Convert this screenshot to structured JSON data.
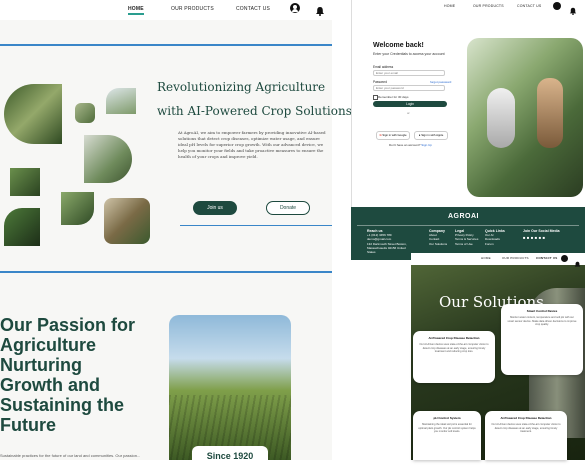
{
  "left_page": {
    "nav": {
      "home": "HOME",
      "products": "OUR PRODUCTS",
      "contact": "CONTACT US"
    },
    "hero": {
      "title_line1": "Revolutionizing Agriculture",
      "title_line2": "with AI-Powered Crop Solutions",
      "body": "At AgroAI, we aim to empower farmers by providing innovative AI-based solutions that detect crop diseases, optimize water usage, and ensure ideal pH levels for superior crop growth. With our advanced device, we help you monitor your fields and take proactive measures to ensure the health of your crops and improve yield.",
      "primary_button": "Join us",
      "secondary_button": "Donate"
    },
    "passion": {
      "line1": "Our Passion for",
      "line2": "Agriculture",
      "line3": "Nurturing",
      "line4": "Growth and",
      "line5": "Sustaining the",
      "line6": "Future",
      "caption": "Sustainable practices for the future of our land and communities. Our passion...",
      "card_label": "Since 1920"
    }
  },
  "login_page": {
    "nav": {
      "home": "HOME",
      "products": "OUR PRODUCTS",
      "contact": "CONTACT US"
    },
    "title": "Welcome back!",
    "subtitle": "Enter your Credentials to access your account",
    "email_label": "Email address",
    "email_placeholder": "Enter your email",
    "password_label": "Password",
    "forgot": "forgot password",
    "password_placeholder": "Enter your password",
    "remember": "Remember for 30 days",
    "login_button": "Login",
    "or": "or",
    "google_button": "Sign in with Google",
    "apple_button": "Sign in with Apple",
    "signup_prompt": "Don't have an account?",
    "signup_link": "Sign Up"
  },
  "footer": {
    "brand": "AGROAI",
    "reach_title": "Reach us",
    "reach_phone": "+1 (012) 3456 789",
    "reach_email": "demo@gmail.com",
    "reach_address": "132 Dartmouth Street Boston, Massachusetts 02156 United States",
    "company_title": "Company",
    "company_items": [
      "About",
      "Contact",
      "Our Solutions"
    ],
    "legal_title": "Legal",
    "legal_items": [
      "Privacy Policy",
      "Terms & Services",
      "Terms of Use"
    ],
    "quick_title": "Quick Links",
    "quick_items": [
      "Our AI",
      "Downloads",
      "Forum"
    ],
    "social_title": "Join Our Social Media"
  },
  "solutions_page": {
    "nav": {
      "home": "HOME",
      "products": "OUR PRODUCTS",
      "contact": "CONTACT US"
    },
    "title": "Our Solutions",
    "cards": [
      {
        "title": "AI-Powered Crop Disease Detection",
        "text": "Our AI-driven device uses state-of-the-art computer vision to detect crop diseases at an early stage, ensuring timely treatment and reducing crop loss."
      },
      {
        "title": "Smart Control Device",
        "text": "Monitor water content, temperature and soil pH with our smart sensor device. Make data driven decisions to improve crop quality."
      },
      {
        "title": "pH Control System",
        "text": "Maintaining the ideal soil pH is essential for optimal plant growth. Our pH control system helps you monitor soil levels."
      },
      {
        "title": "AI-Powered Crop Disease Detection",
        "text": "Our AI-driven device uses state-of-the-art computer vision to detect crop diseases at an early stage, ensuring timely treatment."
      }
    ]
  }
}
